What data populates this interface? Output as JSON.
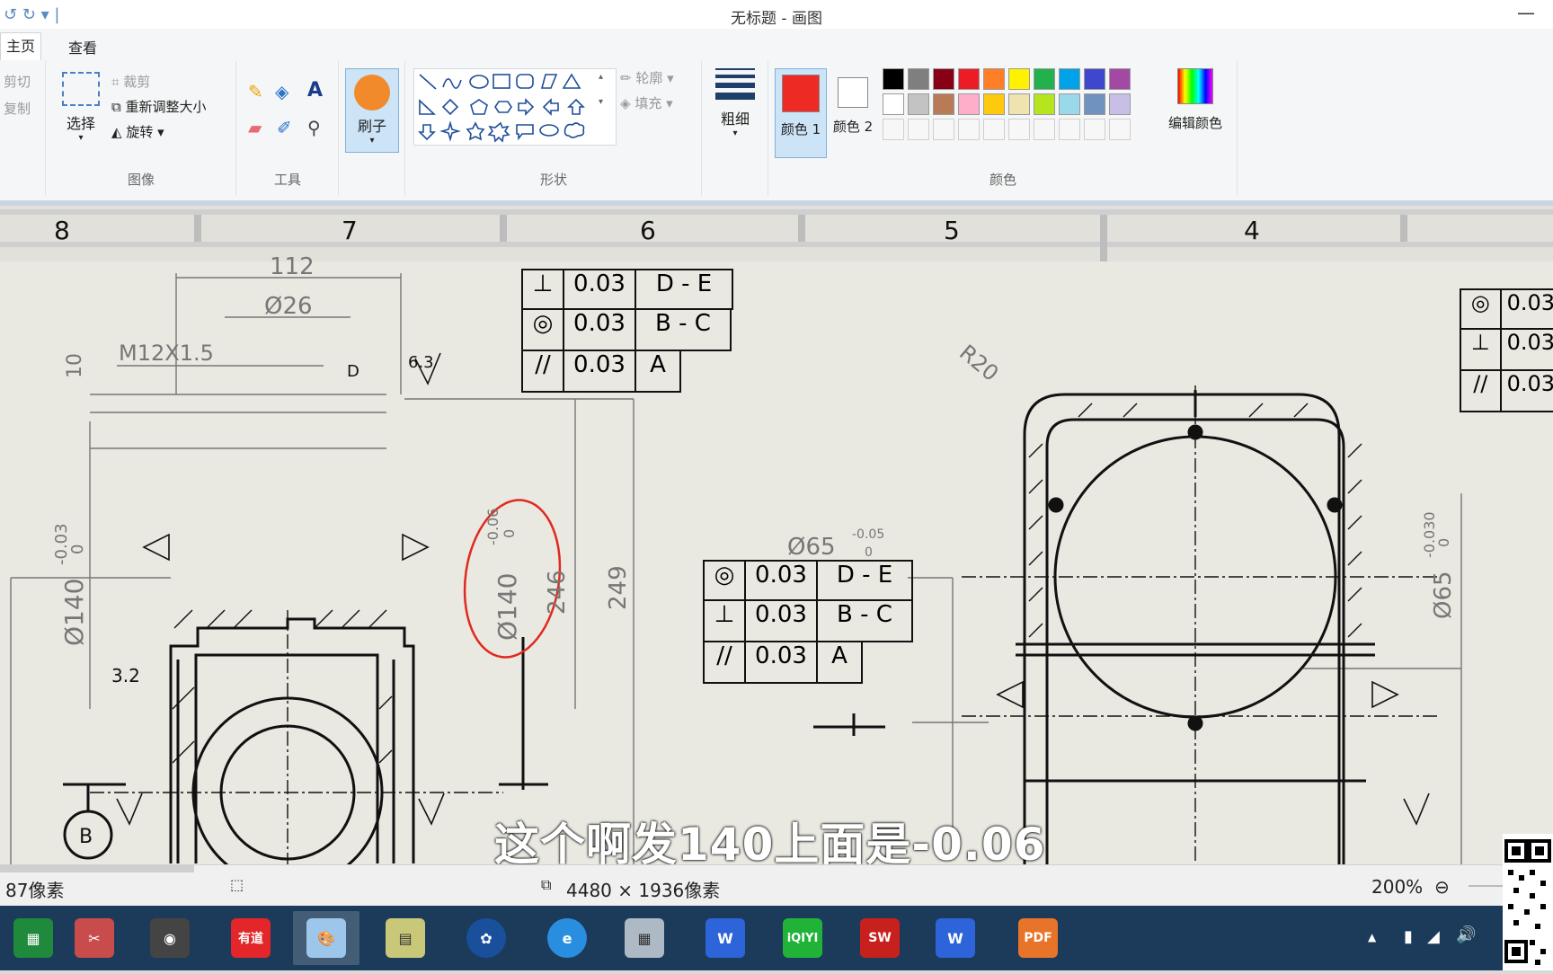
{
  "window": {
    "title": "无标题 - 画图",
    "minimize_icon": "minimize-icon"
  },
  "tabs": [
    {
      "label": "主页"
    },
    {
      "label": "查看"
    }
  ],
  "ribbon": {
    "clipboard": {
      "cut": "剪切",
      "copy": "复制"
    },
    "image": {
      "select": "选择",
      "crop": "裁剪",
      "resize": "重新调整大小",
      "rotate": "旋转",
      "group": "图像"
    },
    "tools": {
      "group": "工具"
    },
    "brush": {
      "label": "刷子"
    },
    "shapes": {
      "outline": "轮廓",
      "fill": "填充",
      "group": "形状"
    },
    "size": {
      "label": "粗细"
    },
    "colors": {
      "color1": "颜色 1",
      "color2": "颜色 2",
      "edit": "编辑颜色",
      "group": "颜色",
      "color1_value": "#ee2a24",
      "color2_value": "#ffffff",
      "row1": [
        "#000000",
        "#7f7f7f",
        "#880015",
        "#ed1c24",
        "#ff7f27",
        "#fff200",
        "#22b14c",
        "#00a2e8",
        "#3f48cc",
        "#a349a4"
      ],
      "row2": [
        "#ffffff",
        "#c3c3c3",
        "#b97a57",
        "#ffaec9",
        "#ffc90e",
        "#efe4b0",
        "#b5e61d",
        "#99d9ea",
        "#7092be",
        "#c8bfe7"
      ]
    }
  },
  "drawing": {
    "ruler": [
      "8",
      "7",
      "6",
      "5",
      "4"
    ],
    "dims": [
      "112",
      "Ø26",
      "M12X1.5",
      "10",
      "6.3",
      "D",
      "-0.03",
      "0",
      "Ø140",
      "-0.06",
      "0",
      "Ø140",
      "246",
      "249",
      "3.2",
      "B",
      "Ø65",
      "-0.05",
      "0",
      "R20",
      "-0.030",
      "0",
      "Ø65"
    ],
    "fcf_top": [
      {
        "value": "0.03",
        "datum": "D - E"
      },
      {
        "value": "0.03",
        "datum": "B - C"
      },
      {
        "value": "0.03",
        "datum": "A"
      }
    ],
    "fcf_mid": [
      {
        "value": "0.03",
        "datum": "D - E"
      },
      {
        "value": "0.03",
        "datum": "B - C"
      },
      {
        "value": "0.03",
        "datum": "A"
      }
    ],
    "fcf_right": [
      "0.03",
      "0.03",
      "0.03"
    ]
  },
  "subtitle": "这个啊发140上面是-0.06",
  "status": {
    "position": "87像素",
    "size": "4480 × 1936像素",
    "zoom": "200%"
  }
}
